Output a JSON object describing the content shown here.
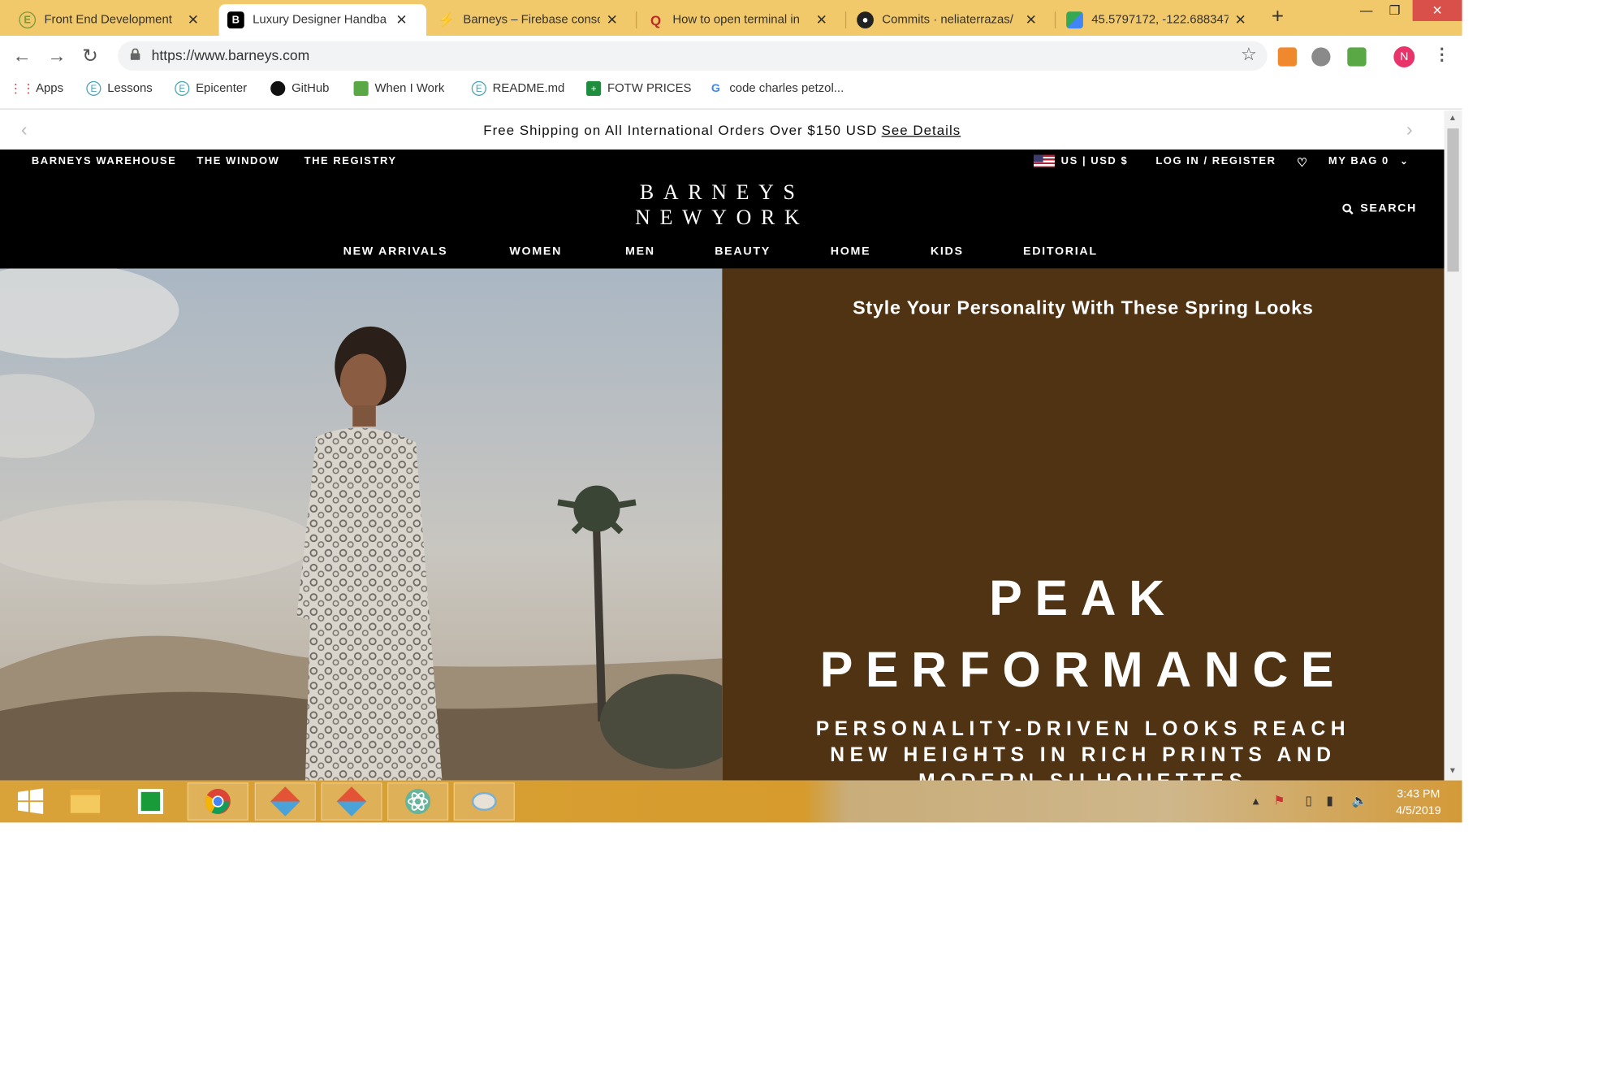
{
  "browser": {
    "tabs": [
      {
        "title": "Front End Development",
        "favicon": "E",
        "active": false
      },
      {
        "title": "Luxury Designer Handba",
        "favicon": "B",
        "active": true
      },
      {
        "title": "Barneys – Firebase conso",
        "favicon": "firebase",
        "active": false
      },
      {
        "title": "How to open terminal in",
        "favicon": "Q",
        "active": false
      },
      {
        "title": "Commits · neliaterrazas/",
        "favicon": "github",
        "active": false
      },
      {
        "title": "45.5797172, -122.688347",
        "favicon": "maps",
        "active": false
      }
    ],
    "url": "https://www.barneys.com",
    "avatar_letter": "N",
    "bookmarks": [
      "Apps",
      "Lessons",
      "Epicenter",
      "GitHub",
      "When I Work",
      "README.md",
      "FOTW PRICES",
      "code charles petzol..."
    ]
  },
  "site": {
    "promo_text": "Free Shipping on All International Orders Over $150 USD",
    "promo_link": "See Details",
    "utility_left": [
      "BARNEYS WAREHOUSE",
      "THE WINDOW",
      "THE REGISTRY"
    ],
    "locale": "US | USD $",
    "login": "LOG IN / REGISTER",
    "bag": "MY BAG 0",
    "logo_line1": "BARNEYS",
    "logo_line2": "NEWYORK",
    "search": "SEARCH",
    "nav": [
      "NEW ARRIVALS",
      "WOMEN",
      "MEN",
      "BEAUTY",
      "HOME",
      "KIDS",
      "EDITORIAL"
    ],
    "hero_kicker": "Style Your Personality With These Spring Looks",
    "hero_title_1": "PEAK",
    "hero_title_2": "PERFORMANCE",
    "hero_sub": "PERSONALITY-DRIVEN LOOKS REACH NEW HEIGHTS IN RICH PRINTS AND MODERN SILHOUETTES",
    "hero_bg": "#4f3313"
  },
  "taskbar": {
    "time": "3:43 PM",
    "date": "4/5/2019",
    "apps": [
      "windows-start-icon",
      "file-explorer-icon",
      "store-icon",
      "chrome-icon",
      "git-icon",
      "git-icon",
      "atom-icon",
      "paint-icon"
    ]
  }
}
